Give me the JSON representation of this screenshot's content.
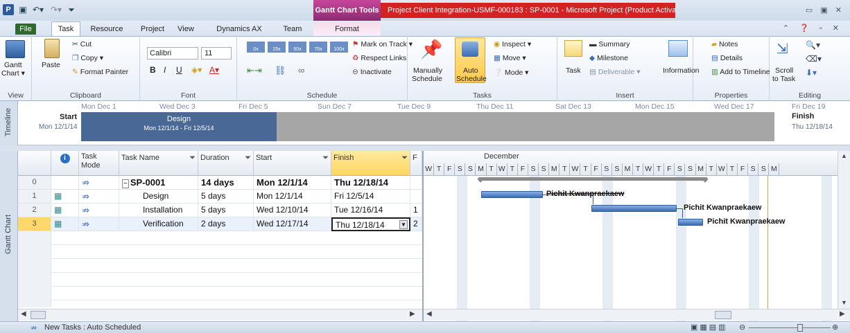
{
  "title_bar": {
    "app_icon": "P",
    "context_tab": "Gantt Chart Tools",
    "title": "Project Client Integration-USMF-000183 : SP-0001  -  Microsoft Project (Product Activation Failed)"
  },
  "tabs": [
    "File",
    "Task",
    "Resource",
    "Project",
    "View",
    "Dynamics AX",
    "Team",
    "Format"
  ],
  "ribbon": {
    "view": {
      "gantt_label": "Gantt",
      "chart_label": "Chart ▾",
      "group": "View"
    },
    "clipboard": {
      "paste": "Paste",
      "cut": "Cut",
      "copy": "Copy ▾",
      "format_painter": "Format Painter",
      "group": "Clipboard"
    },
    "font": {
      "family": "Calibri",
      "size": "11",
      "group": "Font"
    },
    "schedule": {
      "mark_on_track": "Mark on Track ▾",
      "respect_links": "Respect Links",
      "inactivate": "Inactivate",
      "group": "Schedule",
      "pct": [
        "0x",
        "25x",
        "50x",
        "75x",
        "100x"
      ]
    },
    "tasks": {
      "manually": "Manually",
      "manually2": "Schedule",
      "auto": "Auto",
      "auto2": "Schedule",
      "inspect": "Inspect ▾",
      "move": "Move ▾",
      "mode": "Mode ▾",
      "group": "Tasks"
    },
    "insert": {
      "task": "Task",
      "summary": "Summary",
      "milestone": "Milestone",
      "deliverable": "Deliverable ▾",
      "group": "Insert"
    },
    "properties": {
      "information": "Information",
      "notes": "Notes",
      "details": "Details",
      "add_to_timeline": "Add to Timeline",
      "group": "Properties"
    },
    "editing": {
      "scroll": "Scroll",
      "to_task": "to Task",
      "group": "Editing"
    }
  },
  "timeline": {
    "side_label": "Timeline",
    "dates": [
      "Mon Dec 1",
      "Wed Dec 3",
      "Fri Dec 5",
      "Sun Dec 7",
      "Tue Dec 9",
      "Thu Dec 11",
      "Sat Dec 13",
      "Mon Dec 15",
      "Wed Dec 17",
      "Fri Dec 19"
    ],
    "start_label": "Start",
    "start_date": "Mon 12/1/14",
    "finish_label": "Finish",
    "finish_date": "Thu 12/18/14",
    "design_label": "Design",
    "design_range": "Mon 12/1/14 - Fri 12/5/14"
  },
  "sheet": {
    "side_label": "Gantt Chart",
    "headers": {
      "info": "i",
      "task_mode": "Task Mode",
      "task_name": "Task Name",
      "duration": "Duration",
      "start": "Start",
      "finish": "Finish",
      "pred": "F"
    },
    "rows": [
      {
        "id": "0",
        "name": "SP-0001",
        "duration": "14 days",
        "start": "Mon 12/1/14",
        "finish": "Thu 12/18/14",
        "pred": ""
      },
      {
        "id": "1",
        "name": "Design",
        "duration": "5 days",
        "start": "Mon 12/1/14",
        "finish": "Fri 12/5/14",
        "pred": ""
      },
      {
        "id": "2",
        "name": "Installation",
        "duration": "5 days",
        "start": "Wed 12/10/14",
        "finish": "Tue 12/16/14",
        "pred": "1"
      },
      {
        "id": "3",
        "name": "Verification",
        "duration": "2 days",
        "start": "Wed 12/17/14",
        "finish": "Thu 12/18/14",
        "pred": "2"
      }
    ]
  },
  "gantt": {
    "month": "December",
    "days": [
      "W",
      "T",
      "F",
      "S",
      "S",
      "M",
      "T",
      "W",
      "T",
      "F",
      "S",
      "S",
      "M",
      "T",
      "W",
      "T",
      "F",
      "S",
      "S",
      "M",
      "T",
      "W",
      "T",
      "F",
      "S",
      "S",
      "M",
      "T",
      "W",
      "T",
      "F",
      "S",
      "S",
      "M"
    ],
    "resource_labels": [
      "Pichit Kwanpraekaew",
      "Pichit Kwanpraekaew",
      "Pichit Kwanpraekaew"
    ]
  },
  "status": {
    "new_tasks": "New Tasks : Auto Scheduled"
  },
  "colors": {
    "title_red": "#d32222",
    "context_magenta": "#b03a8a",
    "bar_blue": "#3a6cb5",
    "timeline_design": "#4a6896",
    "finish_highlight": "#ffd65e"
  }
}
